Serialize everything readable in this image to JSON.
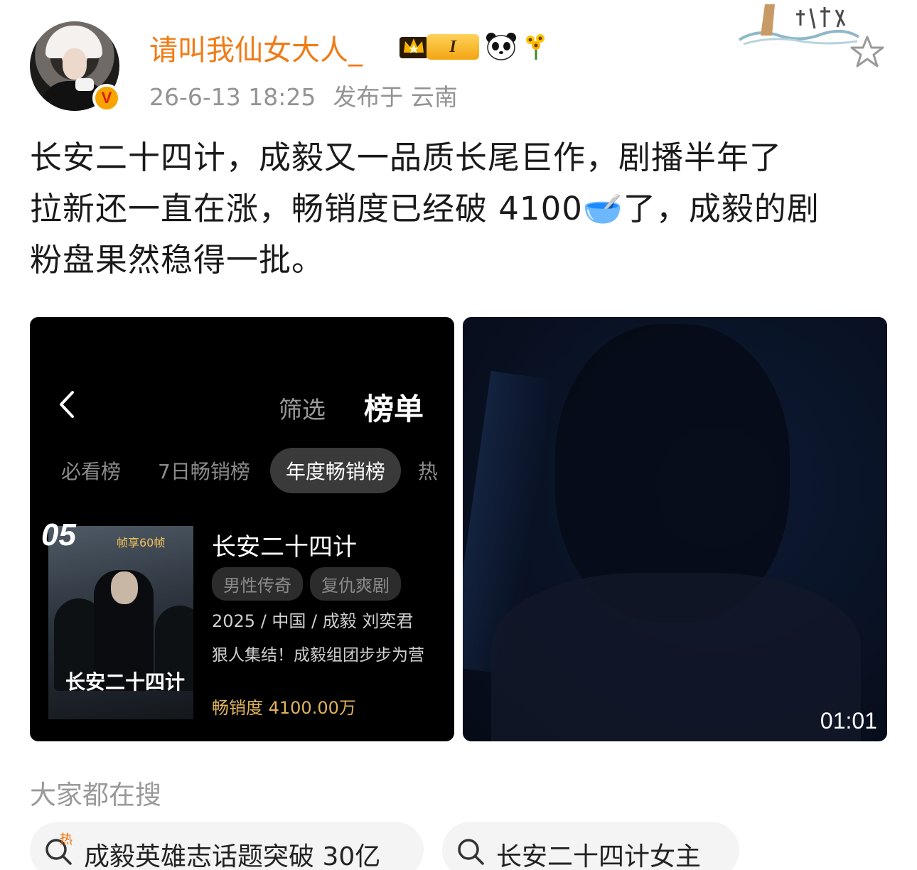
{
  "post": {
    "username": "请叫我仙女大人_",
    "level_badge": "I",
    "timestamp": "26-6-13 18:25",
    "location": "发布于 云南",
    "verified_mark": "V",
    "text_lines": [
      "长安二十四计，成毅又一品质长尾巨作，剧播半年了",
      "拉新还一直在涨，畅销度已经破 4100🥣了，成毅的剧",
      "粉盘果然稳得一批。"
    ]
  },
  "ranking_screenshot": {
    "filter_label": "筛选",
    "rank_label": "榜单",
    "tabs": [
      "必看榜",
      "7日畅销榜",
      "年度畅销榜",
      "热"
    ],
    "active_tab_index": 2,
    "rank_number": "05",
    "poster_frame_label": "帧享60帧",
    "poster_title": "长安二十四计",
    "show_title": "长安二十四计",
    "tags": [
      "男性传奇",
      "复仇爽剧"
    ],
    "info": "2025 / 中国 / 成毅 刘奕君",
    "description": "狠人集结！成毅组团步步为营",
    "sales": "畅销度 4100.00万"
  },
  "video": {
    "duration": "01:01"
  },
  "search": {
    "title": "大家都在搜",
    "chips": [
      {
        "label": "成毅英雄志话题突破 30亿",
        "hot": true,
        "hot_label": "热"
      },
      {
        "label": "长安二十四计女主",
        "hot": false
      }
    ]
  },
  "colors": {
    "username": "#f07b15",
    "meta": "#939393",
    "sales": "#e0b35c",
    "hot": "#f56a00"
  }
}
